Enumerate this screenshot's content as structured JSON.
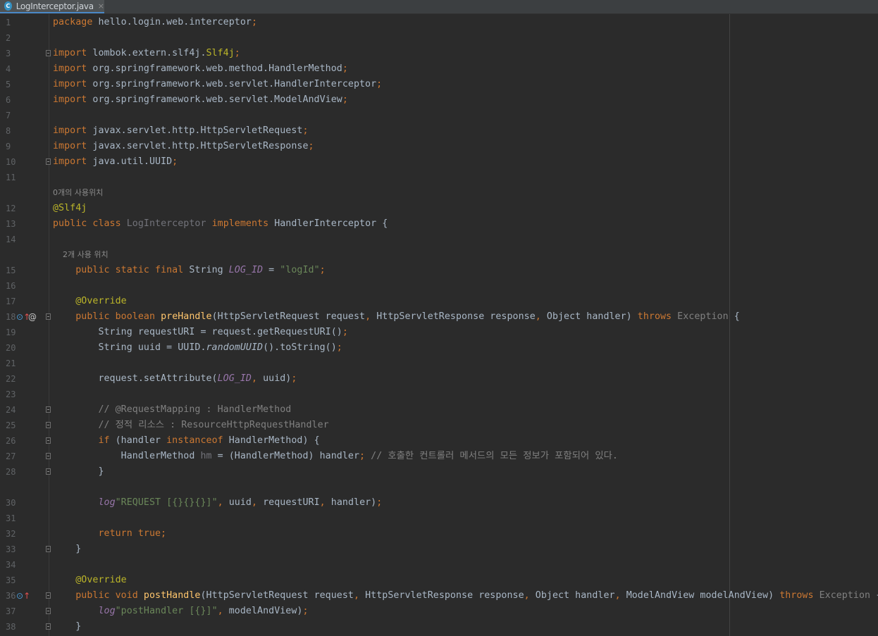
{
  "tab": {
    "icon": "java-class-icon",
    "icon_glyph": "C",
    "filename": "LogInterceptor.java",
    "close": "×"
  },
  "lines": [
    {
      "n": "1",
      "segs": [
        [
          "kw",
          "package "
        ],
        [
          "",
          "hello.login.web.interceptor"
        ],
        [
          "kw",
          ";"
        ]
      ]
    },
    {
      "n": "2",
      "segs": []
    },
    {
      "n": "3",
      "segs": [
        [
          "kw",
          "import "
        ],
        [
          "",
          "lombok.extern.slf4j."
        ],
        [
          "ann",
          "Slf4j"
        ],
        [
          "kw",
          ";"
        ]
      ]
    },
    {
      "n": "4",
      "segs": [
        [
          "kw",
          "import "
        ],
        [
          "",
          "org.springframework.web.method.HandlerMethod"
        ],
        [
          "kw",
          ";"
        ]
      ]
    },
    {
      "n": "5",
      "segs": [
        [
          "kw",
          "import "
        ],
        [
          "",
          "org.springframework.web.servlet.HandlerInterceptor"
        ],
        [
          "kw",
          ";"
        ]
      ]
    },
    {
      "n": "6",
      "segs": [
        [
          "kw",
          "import "
        ],
        [
          "",
          "org.springframework.web.servlet.ModelAndView"
        ],
        [
          "kw",
          ";"
        ]
      ]
    },
    {
      "n": "7",
      "segs": []
    },
    {
      "n": "8",
      "segs": [
        [
          "kw",
          "import "
        ],
        [
          "",
          "javax.servlet.http.HttpServletRequest"
        ],
        [
          "kw",
          ";"
        ]
      ]
    },
    {
      "n": "9",
      "segs": [
        [
          "kw",
          "import "
        ],
        [
          "",
          "javax.servlet.http.HttpServletResponse"
        ],
        [
          "kw",
          ";"
        ]
      ]
    },
    {
      "n": "10",
      "segs": [
        [
          "kw",
          "import "
        ],
        [
          "",
          "java.util.UUID"
        ],
        [
          "kw",
          ";"
        ]
      ]
    },
    {
      "n": "11",
      "segs": []
    },
    {
      "hint": "0개의 사용위치"
    },
    {
      "n": "12",
      "segs": [
        [
          "ann",
          "@Slf4j"
        ]
      ]
    },
    {
      "n": "13",
      "segs": [
        [
          "kw",
          "public class "
        ],
        [
          "unused",
          "LogInterceptor "
        ],
        [
          "kw",
          "implements "
        ],
        [
          "",
          "HandlerInterceptor {"
        ]
      ]
    },
    {
      "n": "14",
      "segs": []
    },
    {
      "hint": "    2개 사용 위치"
    },
    {
      "n": "15",
      "segs": [
        [
          "",
          "    "
        ],
        [
          "kw",
          "public static final "
        ],
        [
          "",
          "String "
        ],
        [
          "const",
          "LOG_ID"
        ],
        [
          "",
          " = "
        ],
        [
          "str",
          "\"logId\""
        ],
        [
          "kw",
          ";"
        ]
      ]
    },
    {
      "n": "16",
      "segs": []
    },
    {
      "n": "17",
      "segs": [
        [
          "",
          "    "
        ],
        [
          "ann",
          "@Override"
        ]
      ]
    },
    {
      "n": "18",
      "segs": [
        [
          "",
          "    "
        ],
        [
          "kw",
          "public boolean "
        ],
        [
          "meth",
          "preHandle"
        ],
        [
          "",
          "(HttpServletRequest request"
        ],
        [
          "kw",
          ", "
        ],
        [
          "",
          "HttpServletResponse response"
        ],
        [
          "kw",
          ", "
        ],
        [
          "",
          "Object handler) "
        ],
        [
          "kw",
          "throws "
        ],
        [
          "gray",
          "Exception "
        ],
        [
          "",
          "{"
        ]
      ]
    },
    {
      "n": "19",
      "segs": [
        [
          "",
          "        String requestURI = request.getRequestURI()"
        ],
        [
          "kw",
          ";"
        ]
      ]
    },
    {
      "n": "20",
      "segs": [
        [
          "",
          "        String uuid = UUID."
        ],
        [
          "stat",
          "randomUUID"
        ],
        [
          "",
          "().toString()"
        ],
        [
          "kw",
          ";"
        ]
      ]
    },
    {
      "n": "21",
      "segs": []
    },
    {
      "n": "22",
      "segs": [
        [
          "",
          "        request.setAttribute("
        ],
        [
          "const",
          "LOG_ID"
        ],
        [
          "kw",
          ", "
        ],
        [
          "",
          "uuid)"
        ],
        [
          "kw",
          ";"
        ]
      ]
    },
    {
      "n": "23",
      "segs": []
    },
    {
      "n": "24",
      "segs": [
        [
          "",
          "        "
        ],
        [
          "cmt",
          "// @RequestMapping : HandlerMethod"
        ]
      ]
    },
    {
      "n": "25",
      "segs": [
        [
          "",
          "        "
        ],
        [
          "cmt",
          "// 정적 리소스 : ResourceHttpRequestHandler"
        ]
      ]
    },
    {
      "n": "26",
      "segs": [
        [
          "",
          "        "
        ],
        [
          "kw",
          "if "
        ],
        [
          "",
          "(handler "
        ],
        [
          "kw",
          "instanceof "
        ],
        [
          "",
          "HandlerMethod) {"
        ]
      ]
    },
    {
      "n": "27",
      "segs": [
        [
          "",
          "            HandlerMethod "
        ],
        [
          "unused",
          "hm"
        ],
        [
          "",
          " = (HandlerMethod) handler"
        ],
        [
          "kw",
          "; "
        ],
        [
          "cmt",
          "// 호출한 컨트롤러 메서드의 모든 정보가 포함되어 있다."
        ]
      ]
    },
    {
      "n": "28",
      "segs": [
        [
          "",
          "        }"
        ]
      ]
    },
    {
      "n": "",
      "segs": []
    },
    {
      "n": "30",
      "segs": [
        [
          "",
          "        "
        ],
        [
          "const",
          "log"
        ],
        [
          ".info("
        ],
        [
          "str",
          "\"REQUEST [{}{}{}]\""
        ],
        [
          "kw",
          ", "
        ],
        [
          "",
          "uuid"
        ],
        [
          "kw",
          ", "
        ],
        [
          "",
          "requestURI"
        ],
        [
          "kw",
          ", "
        ],
        [
          "",
          "handler)"
        ],
        [
          "kw",
          ";"
        ]
      ]
    },
    {
      "n": "31",
      "segs": []
    },
    {
      "n": "32",
      "segs": [
        [
          "",
          "        "
        ],
        [
          "kw",
          "return true;"
        ]
      ]
    },
    {
      "n": "33",
      "segs": [
        [
          "",
          "    }"
        ]
      ]
    },
    {
      "n": "34",
      "segs": []
    },
    {
      "n": "35",
      "segs": [
        [
          "",
          "    "
        ],
        [
          "ann",
          "@Override"
        ]
      ]
    },
    {
      "n": "36",
      "segs": [
        [
          "",
          "    "
        ],
        [
          "kw",
          "public void "
        ],
        [
          "meth",
          "postHandle"
        ],
        [
          "",
          "(HttpServletRequest request"
        ],
        [
          "kw",
          ", "
        ],
        [
          "",
          "HttpServletResponse response"
        ],
        [
          "kw",
          ", "
        ],
        [
          "",
          "Object handler"
        ],
        [
          "kw",
          ", "
        ],
        [
          "",
          "ModelAndView modelAndView) "
        ],
        [
          "kw",
          "throws "
        ],
        [
          "gray",
          "Exception "
        ],
        [
          "",
          "{"
        ]
      ]
    },
    {
      "n": "37",
      "segs": [
        [
          "",
          "        "
        ],
        [
          "const",
          "log"
        ],
        [
          ".info("
        ],
        [
          "str",
          "\"postHandler [{}]\""
        ],
        [
          "kw",
          ", "
        ],
        [
          "",
          "modelAndView)"
        ],
        [
          "kw",
          ";"
        ]
      ]
    },
    {
      "n": "38",
      "segs": [
        [
          "",
          "    }"
        ]
      ]
    }
  ],
  "gutter_marks": [
    {
      "line": "18",
      "icons": [
        "override-method-icon",
        "annotation-at-icon"
      ],
      "glyphs": [
        "⊙↑",
        "@"
      ]
    },
    {
      "line": "36",
      "icons": [
        "override-method-icon"
      ],
      "glyphs": [
        "⊙↑"
      ]
    }
  ],
  "fold_lines": [
    "3",
    "10",
    "18",
    "24",
    "25",
    "26",
    "27",
    "28",
    "33",
    "36",
    "37",
    "38"
  ],
  "colors": {
    "background": "#2b2b2b",
    "keyword": "#cc7832",
    "annotation": "#bbb529",
    "string": "#6a8759",
    "comment": "#808080",
    "constant": "#9876aa",
    "method": "#ffc66d",
    "text": "#a9b7c6"
  }
}
